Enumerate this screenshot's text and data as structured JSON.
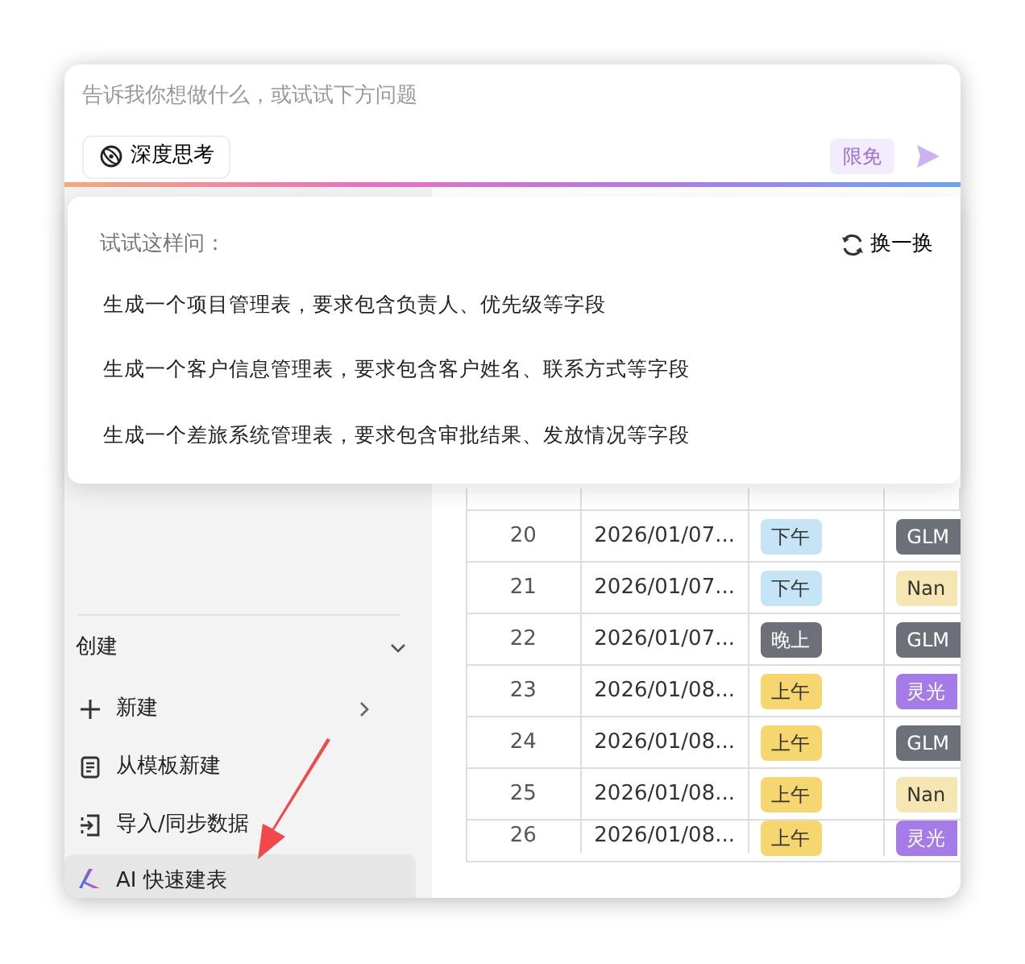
{
  "prompt": {
    "placeholder": "告诉我你想做什么，或试试下方问题",
    "deep_think_label": "深度思考",
    "free_badge": "限免"
  },
  "suggestions": {
    "title": "试试这样问：",
    "refresh_label": "换一换",
    "items": [
      "生成一个项目管理表，要求包含负责人、优先级等字段",
      "生成一个客户信息管理表，要求包含客户姓名、联系方式等字段",
      "生成一个差旅系统管理表，要求包含审批结果、发放情况等字段"
    ]
  },
  "sidebar": {
    "section_title": "创建",
    "expanded": true,
    "items": [
      {
        "kind": "new",
        "label": "新建",
        "has_submenu": true,
        "selected": false
      },
      {
        "kind": "template",
        "label": "从模板新建",
        "has_submenu": false,
        "selected": false
      },
      {
        "kind": "import",
        "label": "导入/同步数据",
        "has_submenu": false,
        "selected": false
      },
      {
        "kind": "ai",
        "label": "AI 快速建表",
        "has_submenu": false,
        "selected": true
      }
    ]
  },
  "table": {
    "rows": [
      {
        "index": "20",
        "date": "2026/01/07...",
        "slot": {
          "label": "下午",
          "color": "#c5e4f5"
        },
        "model": {
          "label": "GLM",
          "color": "#6d7078"
        }
      },
      {
        "index": "21",
        "date": "2026/01/07...",
        "slot": {
          "label": "下午",
          "color": "#c5e4f5"
        },
        "model": {
          "label": "Nan",
          "color": "#f5e6b4"
        }
      },
      {
        "index": "22",
        "date": "2026/01/07...",
        "slot": {
          "label": "晚上",
          "color": "#6d7078"
        },
        "model": {
          "label": "GLM",
          "color": "#6d7078"
        }
      },
      {
        "index": "23",
        "date": "2026/01/08...",
        "slot": {
          "label": "上午",
          "color": "#f6d66e"
        },
        "model": {
          "label": "灵光",
          "color": "#a57be8"
        }
      },
      {
        "index": "24",
        "date": "2026/01/08...",
        "slot": {
          "label": "上午",
          "color": "#f6d66e"
        },
        "model": {
          "label": "GLM",
          "color": "#6d7078"
        }
      },
      {
        "index": "25",
        "date": "2026/01/08...",
        "slot": {
          "label": "上午",
          "color": "#f6d66e"
        },
        "model": {
          "label": "Nan",
          "color": "#f5e6b4"
        }
      },
      {
        "index": "26",
        "date": "2026/01/08...",
        "slot": {
          "label": "上午",
          "color": "#f6d66e"
        },
        "model": {
          "label": "灵光",
          "color": "#a57be8"
        }
      }
    ]
  }
}
